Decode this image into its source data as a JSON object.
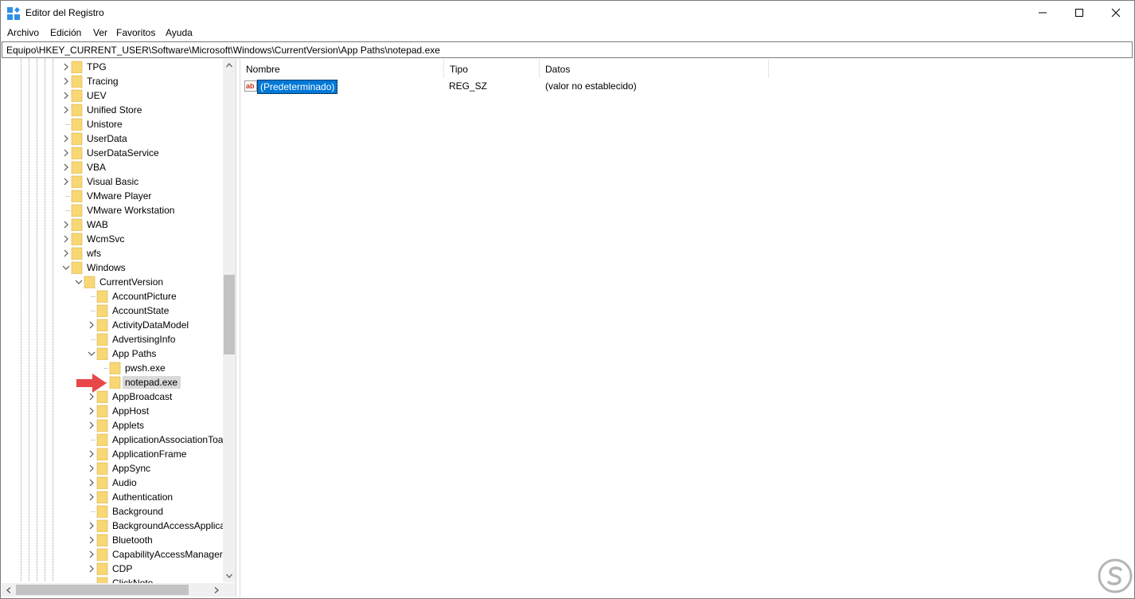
{
  "window": {
    "title": "Editor del Registro"
  },
  "menu": [
    "Archivo",
    "Edición",
    "Ver",
    "Favoritos",
    "Ayuda"
  ],
  "address": "Equipo\\HKEY_CURRENT_USER\\Software\\Microsoft\\Windows\\CurrentVersion\\App Paths\\notepad.exe",
  "tree": [
    {
      "label": "TPG",
      "depth": 0,
      "expander": "collapsed"
    },
    {
      "label": "Tracing",
      "depth": 0,
      "expander": "collapsed"
    },
    {
      "label": "UEV",
      "depth": 0,
      "expander": "collapsed"
    },
    {
      "label": "Unified Store",
      "depth": 0,
      "expander": "collapsed"
    },
    {
      "label": "Unistore",
      "depth": 0,
      "expander": "none"
    },
    {
      "label": "UserData",
      "depth": 0,
      "expander": "collapsed"
    },
    {
      "label": "UserDataService",
      "depth": 0,
      "expander": "collapsed"
    },
    {
      "label": "VBA",
      "depth": 0,
      "expander": "collapsed"
    },
    {
      "label": "Visual Basic",
      "depth": 0,
      "expander": "collapsed"
    },
    {
      "label": "VMware Player",
      "depth": 0,
      "expander": "none"
    },
    {
      "label": "VMware Workstation",
      "depth": 0,
      "expander": "none"
    },
    {
      "label": "WAB",
      "depth": 0,
      "expander": "collapsed"
    },
    {
      "label": "WcmSvc",
      "depth": 0,
      "expander": "collapsed"
    },
    {
      "label": "wfs",
      "depth": 0,
      "expander": "collapsed"
    },
    {
      "label": "Windows",
      "depth": 0,
      "expander": "expanded"
    },
    {
      "label": "CurrentVersion",
      "depth": 1,
      "expander": "expanded"
    },
    {
      "label": "AccountPicture",
      "depth": 2,
      "expander": "none"
    },
    {
      "label": "AccountState",
      "depth": 2,
      "expander": "none"
    },
    {
      "label": "ActivityDataModel",
      "depth": 2,
      "expander": "collapsed"
    },
    {
      "label": "AdvertisingInfo",
      "depth": 2,
      "expander": "none"
    },
    {
      "label": "App Paths",
      "depth": 2,
      "expander": "expanded"
    },
    {
      "label": "pwsh.exe",
      "depth": 3,
      "expander": "none"
    },
    {
      "label": "notepad.exe",
      "depth": 3,
      "expander": "none",
      "selected": true
    },
    {
      "label": "AppBroadcast",
      "depth": 2,
      "expander": "collapsed"
    },
    {
      "label": "AppHost",
      "depth": 2,
      "expander": "collapsed"
    },
    {
      "label": "Applets",
      "depth": 2,
      "expander": "collapsed"
    },
    {
      "label": "ApplicationAssociationToa",
      "depth": 2,
      "expander": "none"
    },
    {
      "label": "ApplicationFrame",
      "depth": 2,
      "expander": "collapsed"
    },
    {
      "label": "AppSync",
      "depth": 2,
      "expander": "collapsed"
    },
    {
      "label": "Audio",
      "depth": 2,
      "expander": "collapsed"
    },
    {
      "label": "Authentication",
      "depth": 2,
      "expander": "collapsed"
    },
    {
      "label": "Background",
      "depth": 2,
      "expander": "none"
    },
    {
      "label": "BackgroundAccessApplica",
      "depth": 2,
      "expander": "collapsed"
    },
    {
      "label": "Bluetooth",
      "depth": 2,
      "expander": "collapsed"
    },
    {
      "label": "CapabilityAccessManager",
      "depth": 2,
      "expander": "collapsed"
    },
    {
      "label": "CDP",
      "depth": 2,
      "expander": "collapsed"
    },
    {
      "label": "ClickNote",
      "depth": 2,
      "expander": "none"
    }
  ],
  "columns": [
    "Nombre",
    "Tipo",
    "Datos"
  ],
  "values": [
    {
      "icon": "string-value-icon",
      "icon_text": "ab",
      "name": "(Predeterminado)",
      "type": "REG_SZ",
      "data": "(valor no establecido)"
    }
  ],
  "colors": {
    "selection": "#0078d7",
    "tree_selection": "#d9d9d9",
    "folder": "#f8d775",
    "pointer_arrow": "#e8474a"
  },
  "icons": {
    "app": "registry-editor-icon",
    "minimize": "minimize-icon",
    "maximize": "maximize-icon",
    "close": "close-icon",
    "folder": "folder-icon",
    "pointer": "red-arrow-icon",
    "watermark": "solvetic-logo-icon"
  }
}
